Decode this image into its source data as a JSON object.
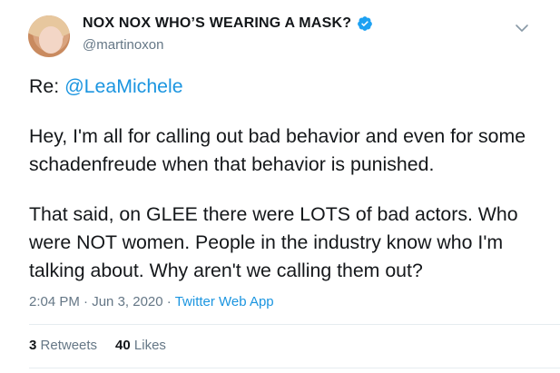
{
  "tweet": {
    "author_name": "NOX NOX WHO’S WEARING A MASK?",
    "author_handle": "@martinoxon",
    "reply_prefix": "Re: ",
    "reply_mention": "@LeaMichele",
    "para1": "Hey, I'm all for calling out bad behavior and even for some schadenfreude when that behavior is punished.",
    "para2": "That said, on GLEE there were LOTS of bad actors. Who were NOT women. People in the industry know who I'm talking about. Why aren't we calling them out?",
    "time": "2:04 PM",
    "date": "Jun 3, 2020",
    "separator": " · ",
    "source_app": "Twitter Web App",
    "retweets_count": "3",
    "retweets_label": "Retweets",
    "likes_count": "40",
    "likes_label": "Likes"
  },
  "icons": {
    "verified": "verified-badge-icon",
    "more": "chevron-down-icon"
  },
  "colors": {
    "link": "#1b95e0",
    "secondary_text": "#657786",
    "verified": "#1da1f2"
  }
}
